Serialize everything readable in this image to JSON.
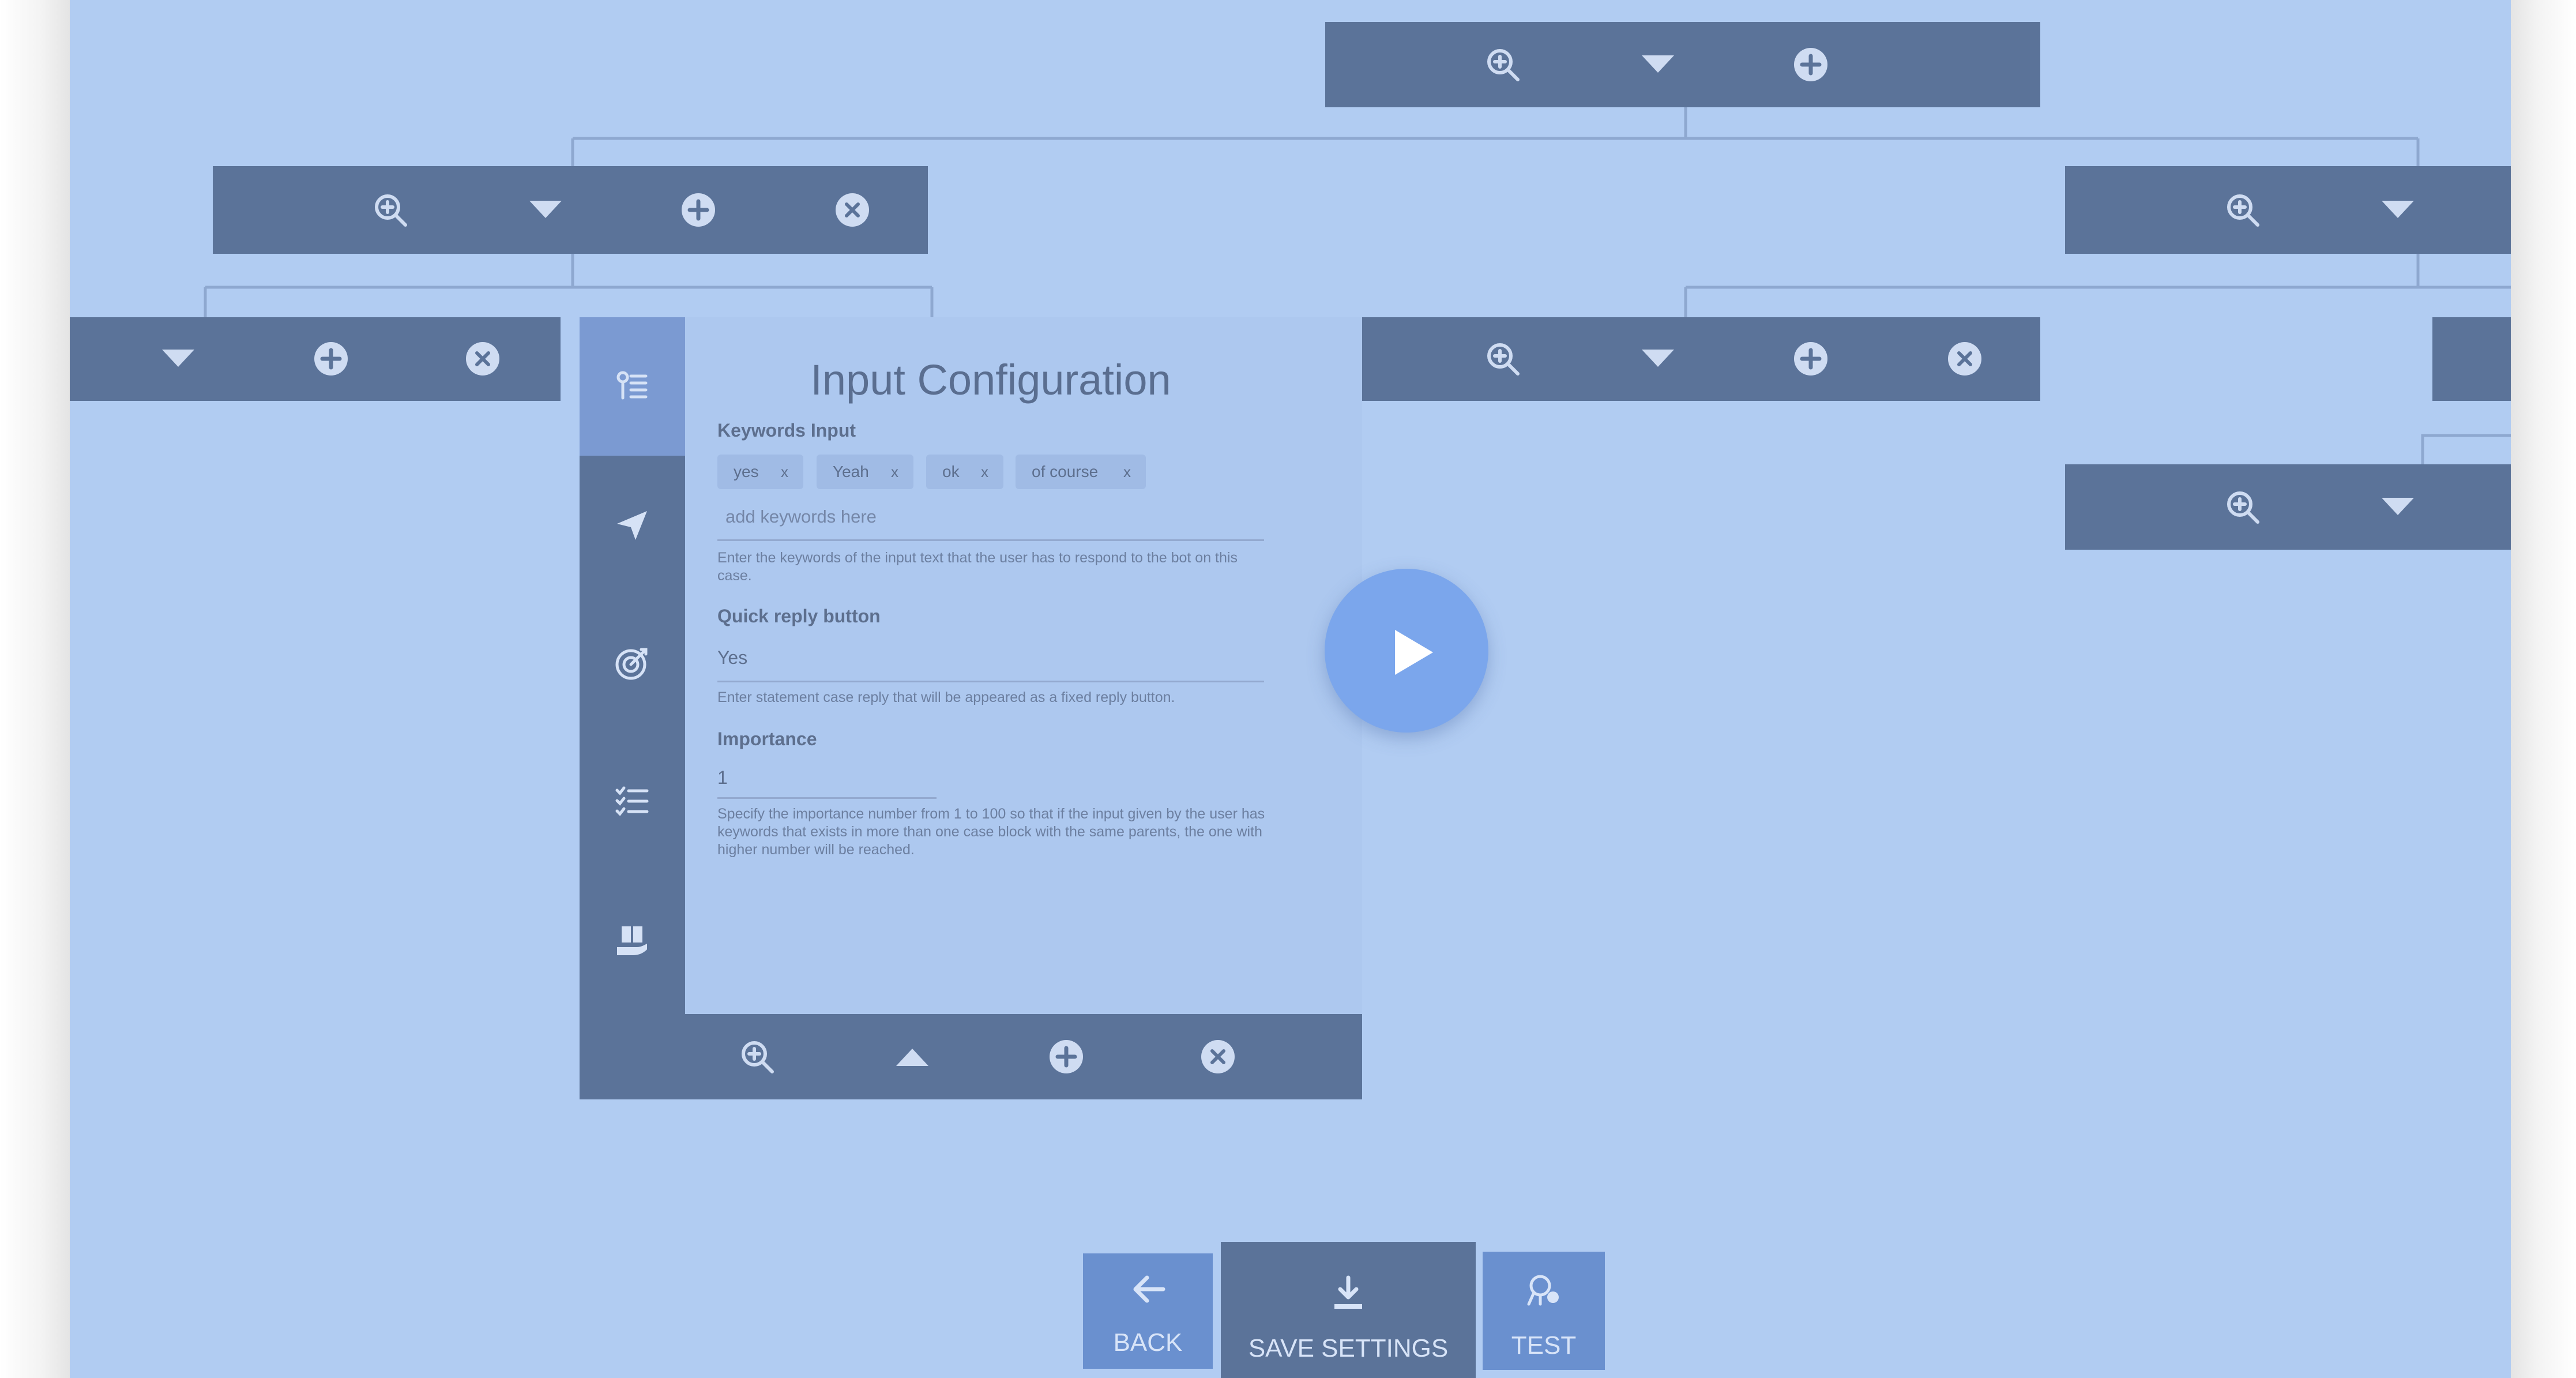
{
  "config_panel": {
    "title": "Input Configuration",
    "keywords": {
      "label": "Keywords Input",
      "chips": [
        "yes",
        "Yeah",
        "ok",
        "of course"
      ],
      "remove_glyph": "x",
      "placeholder": "add keywords here",
      "help": "Enter the keywords of the input text that the user has to respond to the bot on this case."
    },
    "quick_reply": {
      "label": "Quick reply button",
      "value": "Yes",
      "help": "Enter statement case reply that will be appeared as a fixed reply button."
    },
    "importance": {
      "label": "Importance",
      "value": "1",
      "help": "Specify the importance number from 1 to 100 so that if the input given by the user has keywords that exists in more than one case block with the same parents, the one with higher number will be reached."
    },
    "side_tabs": [
      "input-config-icon",
      "send-icon",
      "target-icon",
      "checklist-icon",
      "book-hand-icon"
    ]
  },
  "video": {
    "play_icon": "play-icon"
  },
  "footer": {
    "back_label": "BACK",
    "save_label": "SAVE SETTINGS",
    "test_label": "TEST"
  },
  "node_icons": [
    "zoom-in-icon",
    "caret-down-icon",
    "caret-up-icon",
    "plus-circle-icon",
    "close-circle-icon"
  ],
  "colors": {
    "canvas": "#b1ccf2",
    "node": "#5b7399",
    "active_tab": "#7b9ad2",
    "play_button": "#7ba6ec",
    "button": "#6a90cf"
  }
}
